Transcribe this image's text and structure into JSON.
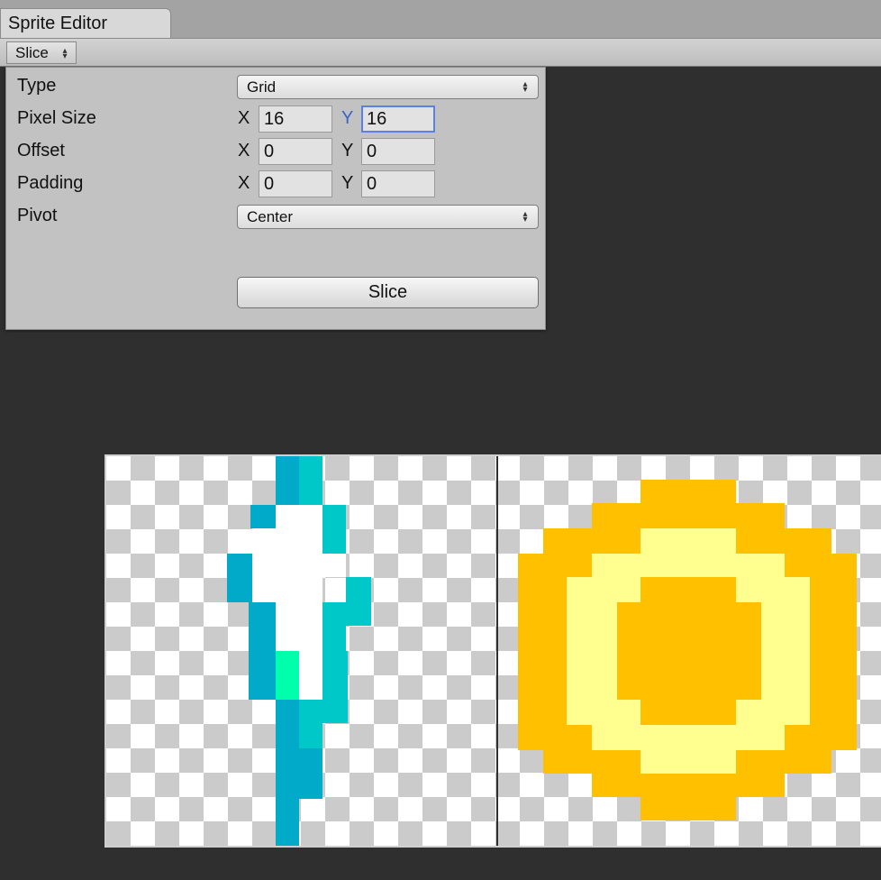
{
  "window": {
    "tab_title": "Sprite Editor"
  },
  "toolbar": {
    "slice_menu_label": "Slice"
  },
  "slice_panel": {
    "type_label": "Type",
    "type_value": "Grid",
    "pixel_size_label": "Pixel Size",
    "pixel_size": {
      "x_axis": "X",
      "x": "16",
      "y_axis": "Y",
      "y": "16"
    },
    "offset_label": "Offset",
    "offset": {
      "x_axis": "X",
      "x": "0",
      "y_axis": "Y",
      "y": "0"
    },
    "padding_label": "Padding",
    "padding": {
      "x_axis": "X",
      "x": "0",
      "y_axis": "Y",
      "y": "0"
    },
    "pivot_label": "Pivot",
    "pivot_value": "Center",
    "slice_button": "Slice"
  },
  "colors": {
    "canvas_bg": "#2f2f2f",
    "panel_bg": "#c2c2c2",
    "focus_blue": "#3c63c9",
    "feather_dark": "#00aac8",
    "feather_mid": "#00c8c8",
    "feather_light": "#00ffaa",
    "feather_white": "#ffffff",
    "coin_gold": "#ffc000",
    "coin_pale": "#ffff90"
  },
  "sprites": [
    "feather-sprite",
    "coin-sprite"
  ]
}
